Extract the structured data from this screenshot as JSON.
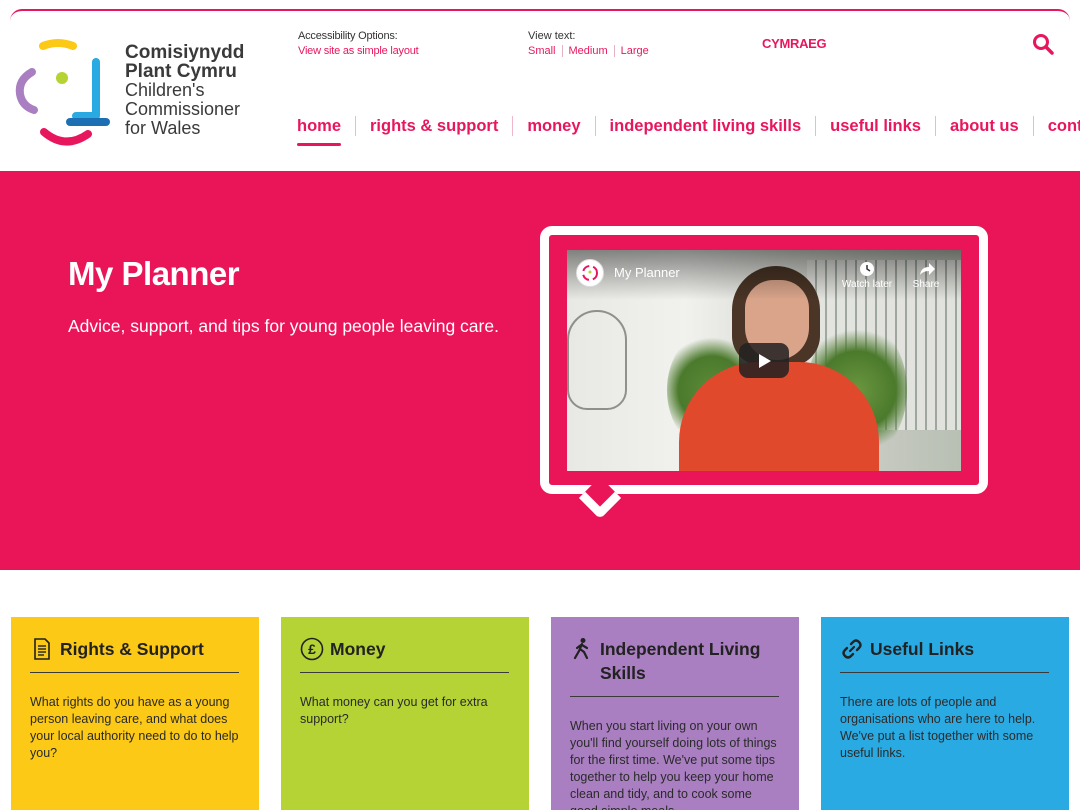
{
  "org": {
    "name_cy_line1": "Comisiynydd",
    "name_cy_line2": "Plant Cymru",
    "name_en_line1": "Children's",
    "name_en_line2": "Commissioner",
    "name_en_line3": "for Wales"
  },
  "accessibility": {
    "title": "Accessibility Options:",
    "simple_link": "View site as simple layout"
  },
  "view_text": {
    "title": "View text:",
    "sizes": [
      "Small",
      "Medium",
      "Large"
    ]
  },
  "language_link": "CYMRAEG",
  "nav": {
    "items": [
      {
        "label": "home",
        "active": true
      },
      {
        "label": "rights & support"
      },
      {
        "label": "money"
      },
      {
        "label": "independent living skills"
      },
      {
        "label": "useful links"
      },
      {
        "label": "about us"
      },
      {
        "label": "contact"
      }
    ]
  },
  "hero": {
    "title": "My Planner",
    "subtitle": "Advice, support, and tips for young people leaving care."
  },
  "video": {
    "title": "My Planner",
    "watch_later": "Watch later",
    "share": "Share"
  },
  "cards": [
    {
      "title": "Rights & Support",
      "icon": "document-icon",
      "text": "What rights do you have as a young person leaving care, and what does your local authority need to do to help you?"
    },
    {
      "title": "Money",
      "icon": "pound-coin-icon",
      "text": "What money can you get for extra support?"
    },
    {
      "title": "Independent Living Skills",
      "icon": "walking-person-icon",
      "text": "When you start living on your own you'll find yourself doing lots of things for the first time. We've put some tips together to help you keep your home clean and tidy, and to cook some good simple meals."
    },
    {
      "title": "Useful Links",
      "icon": "link-icon",
      "text": "There are lots of people and organisations who are here to help. We've put a list together with some useful links."
    }
  ],
  "colors": {
    "brand_pink": "#ea1559",
    "card_yellow": "#fcc917",
    "card_green": "#b5d334",
    "card_purple": "#a97fc1",
    "card_blue": "#2aaae2"
  }
}
